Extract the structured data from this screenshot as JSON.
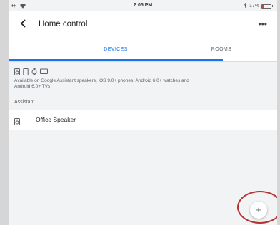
{
  "status_bar": {
    "time": "2:05 PM",
    "battery_text": "17%",
    "battery_level": 0.17,
    "icons": [
      "airplane-icon",
      "wifi-icon",
      "bluetooth-icon",
      "battery-icon"
    ]
  },
  "header": {
    "title": "Home control",
    "back_icon": "back-arrow-icon",
    "more_label": "•••"
  },
  "tabs": [
    {
      "label": "DEVICES",
      "active": true
    },
    {
      "label": "ROOMS",
      "active": false
    }
  ],
  "availability": {
    "icons": [
      "speaker-icon",
      "phone-icon",
      "watch-icon",
      "tv-icon"
    ],
    "text": "Available on Google Assistant speakers, iOS 9.0+ phones, Android 6.0+ watches and Android 6.0+ TVs"
  },
  "section": {
    "label": "Assistant"
  },
  "devices": [
    {
      "name": "Office Speaker",
      "icon": "speaker-icon"
    }
  ],
  "fab": {
    "label": "+",
    "icon": "add-icon"
  },
  "colors": {
    "accent": "#1a73e8",
    "highlight": "#b33232",
    "background": "#f1f3f4"
  }
}
